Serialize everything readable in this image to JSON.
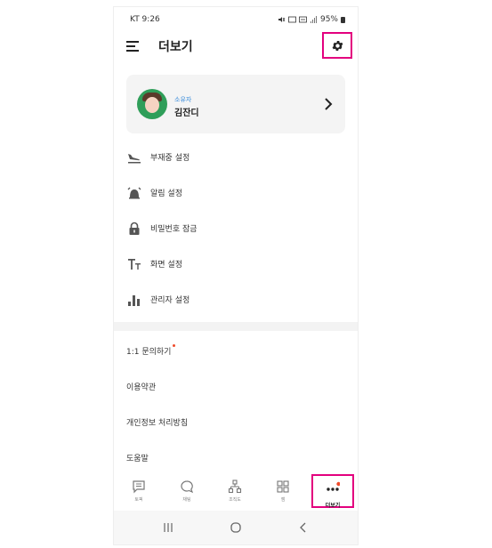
{
  "status_bar": {
    "carrier_time": "KT 9:26",
    "battery": "95%"
  },
  "header": {
    "title": "더보기",
    "menu_icon": "hamburger-menu-icon",
    "settings_icon": "gear-icon"
  },
  "profile": {
    "role": "소유자",
    "name": "김잔디"
  },
  "menu": {
    "items": [
      {
        "label": "부재중 설정",
        "icon": "airplane-landing-icon"
      },
      {
        "label": "알림 설정",
        "icon": "alarm-bell-icon"
      },
      {
        "label": "비밀번호 잠금",
        "icon": "lock-icon"
      },
      {
        "label": "화면 설정",
        "icon": "text-size-icon"
      },
      {
        "label": "관리자 설정",
        "icon": "bar-chart-icon"
      }
    ]
  },
  "support": {
    "items": [
      {
        "label": "1:1 문의하기"
      },
      {
        "label": "이용약관"
      },
      {
        "label": "개인정보 처리방침"
      },
      {
        "label": "도움말"
      }
    ]
  },
  "bottom_nav": {
    "items": [
      {
        "label": "토픽",
        "icon": "chat-icon"
      },
      {
        "label": "채팅",
        "icon": "speech-bubble-icon"
      },
      {
        "label": "조직도",
        "icon": "org-chart-icon"
      },
      {
        "label": "잼",
        "icon": "grid-icon"
      },
      {
        "label": "더보기",
        "icon": "more-dots-icon"
      }
    ]
  },
  "colors": {
    "highlight": "#e3007e",
    "accent_blue": "#3a8ddb",
    "notification_dot": "#f04b2b"
  }
}
